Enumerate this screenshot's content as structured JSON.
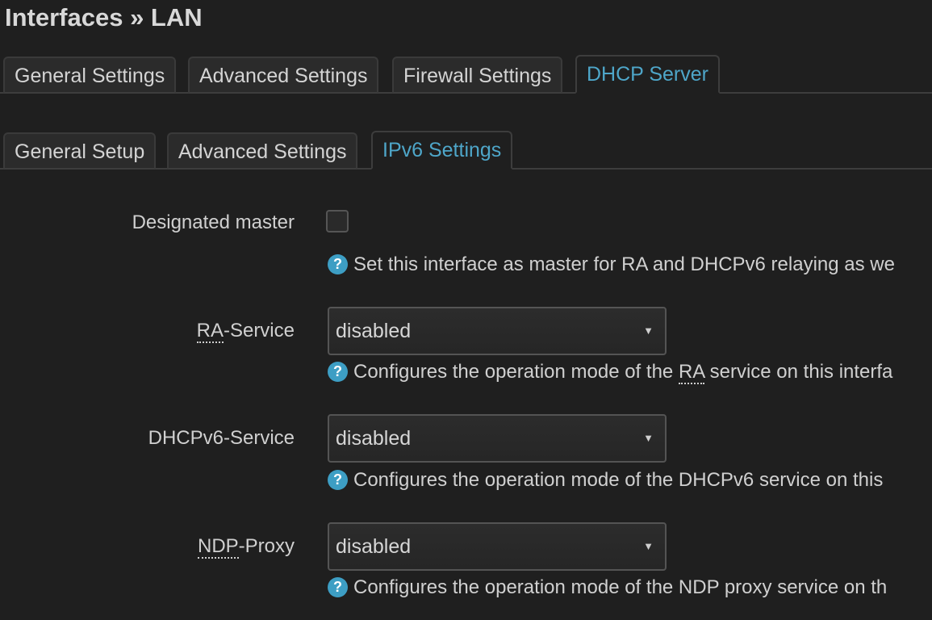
{
  "page": {
    "title": "Interfaces » LAN"
  },
  "main_tabs": [
    {
      "label": "General Settings"
    },
    {
      "label": "Advanced Settings"
    },
    {
      "label": "Firewall Settings"
    },
    {
      "label": "DHCP Server"
    }
  ],
  "sub_tabs": [
    {
      "label": "General Setup"
    },
    {
      "label": "Advanced Settings"
    },
    {
      "label": "IPv6 Settings"
    }
  ],
  "fields": {
    "designated_master": {
      "label": "Designated master",
      "checked": false,
      "help_text": "Set this interface as master for RA and DHCPv6 relaying as we"
    },
    "ra_service": {
      "label_abbr": "RA",
      "label_rest": "-Service",
      "value": "disabled",
      "help_prefix": "Configures the operation mode of the ",
      "help_abbr": "RA",
      "help_suffix": " service on this interfa"
    },
    "dhcpv6_service": {
      "label": "DHCPv6-Service",
      "value": "disabled",
      "help_text": "Configures the operation mode of the DHCPv6 service on this"
    },
    "ndp_proxy": {
      "label_abbr": "NDP",
      "label_rest": "-Proxy",
      "value": "disabled",
      "help_text": "Configures the operation mode of the NDP proxy service on th"
    }
  },
  "icons": {
    "help": "question-circle-icon",
    "caret": "caret-down-icon"
  },
  "colors": {
    "background": "#1f1f1f",
    "accent": "#4ea6c9",
    "help_icon": "#3d9ec4"
  }
}
